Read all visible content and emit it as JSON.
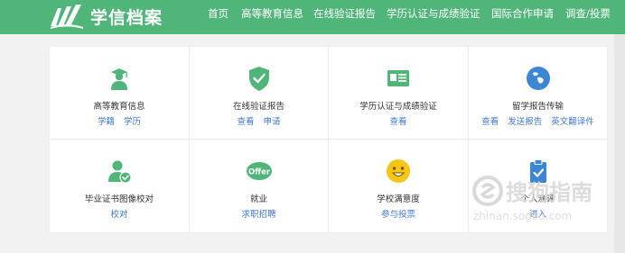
{
  "header": {
    "logo_text": "学信档案",
    "nav": [
      "首页",
      "高等教育信息",
      "在线验证报告",
      "学历认证与成绩验证",
      "国际合作申请",
      "调查/投票"
    ]
  },
  "services": [
    {
      "title": "高等教育信息",
      "links": [
        "学籍",
        "学历"
      ],
      "icon": "graduate-icon"
    },
    {
      "title": "在线验证报告",
      "links": [
        "查看",
        "申请"
      ],
      "icon": "shield-check-icon"
    },
    {
      "title": "学历认证与成绩验证",
      "links": [
        "查看"
      ],
      "icon": "id-card-icon"
    },
    {
      "title": "留学报告传输",
      "links": [
        "查看",
        "发送报告",
        "英文翻译件"
      ],
      "icon": "globe-icon"
    },
    {
      "title": "毕业证书图像校对",
      "links": [
        "校对"
      ],
      "icon": "user-check-icon"
    },
    {
      "title": "就业",
      "links": [
        "求职招聘"
      ],
      "icon": "offer-icon"
    },
    {
      "title": "学校满意度",
      "links": [
        "参与投票"
      ],
      "icon": "smiley-icon"
    },
    {
      "title": "个人测评",
      "links": [
        "进入"
      ],
      "icon": "clipboard-check-icon"
    }
  ],
  "watermark": {
    "text": "搜狗指南",
    "subtext": "zhinan.sogou.com"
  },
  "colors": {
    "brand_green": "#4fb579",
    "link_blue": "#3f7ad6",
    "icon_green": "#4fb579",
    "icon_blue": "#3c86d6",
    "icon_yellow": "#f5c518"
  }
}
